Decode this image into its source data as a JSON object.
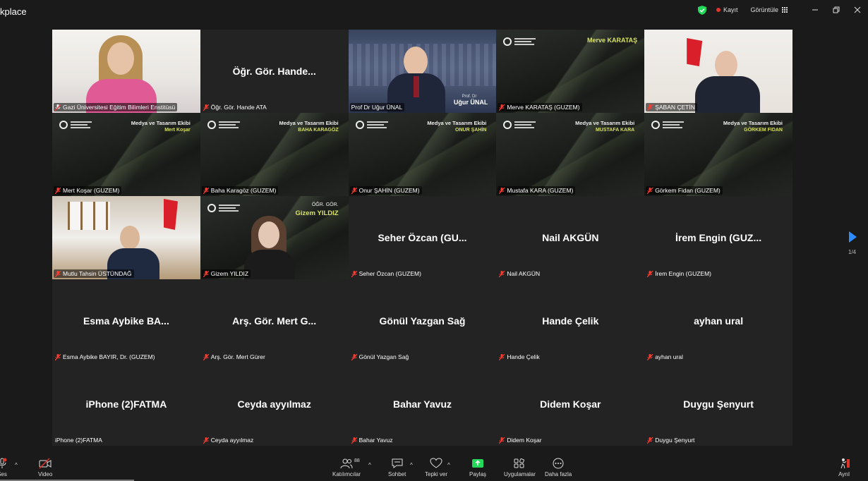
{
  "window": {
    "title": "kplace",
    "recording_label": "Kayıt",
    "view_label": "Görüntüle",
    "colors": {
      "accent": "#2d8cff",
      "active_speaker": "#23d959",
      "recording": "#e0332a",
      "share": "#23d959"
    }
  },
  "tiles": [
    {
      "label": "Gazi Üniversitesi Eğitim Bilimleri Enstitüsü",
      "center": "",
      "type": "photo-woman",
      "active": true
    },
    {
      "label": "Öğr. Gör. Hande ATA",
      "center": "Öğr. Gör. Hande...",
      "type": "plain"
    },
    {
      "label": "Prof Dr Uğur ÜNAL",
      "center": "",
      "type": "photo-prof",
      "caption1": "Prof. Dr",
      "caption2": "Uğur ÜNAL"
    },
    {
      "label": "Merve KARATAŞ (GUZEM)",
      "center": "",
      "type": "guzem-merve",
      "name": "Merve KARATAŞ"
    },
    {
      "label": "ŞABAN ÇETİN",
      "center": "",
      "type": "photo-office"
    },
    {
      "label": "Mert Koşar (GUZEM)",
      "center": "",
      "type": "guzem",
      "title": "Medya ve Tasarım Ekibi",
      "name": "Mert Koşar"
    },
    {
      "label": "Baha Karagöz (GUZEM)",
      "center": "",
      "type": "guzem",
      "title": "Medya ve Tasarım Ekibi",
      "name": "BAHA KARAGÖZ"
    },
    {
      "label": "Onur ŞAHİN (GUZEM)",
      "center": "",
      "type": "guzem",
      "title": "Medya ve Tasarım Ekibi",
      "name": "ONUR ŞAHİN"
    },
    {
      "label": "Mustafa KARA (GUZEM)",
      "center": "",
      "type": "guzem",
      "title": "Medya ve Tasarım Ekibi",
      "name": "MUSTAFA KARA"
    },
    {
      "label": "Görkem Fidan (GUZEM)",
      "center": "",
      "type": "guzem",
      "title": "Medya ve Tasarım Ekibi",
      "name": "GÖRKEM FIDAN"
    },
    {
      "label": "Mutlu Tahsin ÜSTÜNDAĞ",
      "center": "",
      "type": "photo-mutlu"
    },
    {
      "label": "Gizem YILDIZ",
      "center": "",
      "type": "guzem-gizem",
      "role": "ÖĞR. GÖR.",
      "name": "Gizem YILDIZ"
    },
    {
      "label": "Seher Özcan (GUZEM)",
      "center": "Seher Özcan (GU...",
      "type": "plain"
    },
    {
      "label": "Nail AKGÜN",
      "center": "Nail AKGÜN",
      "type": "plain"
    },
    {
      "label": "İrem Engin (GUZEM)",
      "center": "İrem Engin (GUZ...",
      "type": "plain"
    },
    {
      "label": "Esma Aybike BAYIR, Dr. (GUZEM)",
      "center": "Esma Aybike BA...",
      "type": "plain"
    },
    {
      "label": "Arş. Gör. Mert Gürer",
      "center": "Arş. Gör. Mert G...",
      "type": "plain"
    },
    {
      "label": "Gönül Yazgan Sağ",
      "center": "Gönül Yazgan Sağ",
      "type": "plain"
    },
    {
      "label": "Hande Çelik",
      "center": "Hande Çelik",
      "type": "plain"
    },
    {
      "label": "ayhan ural",
      "center": "ayhan ural",
      "type": "plain"
    },
    {
      "label": "iPhone (2)FATMA",
      "center": "iPhone (2)FATMA",
      "type": "plain",
      "no_mic_icon": true
    },
    {
      "label": "Ceyda ayyılmaz",
      "center": "Ceyda ayyılmaz",
      "type": "plain"
    },
    {
      "label": "Bahar Yavuz",
      "center": "Bahar Yavuz",
      "type": "plain"
    },
    {
      "label": "Didem Koşar",
      "center": "Didem Koşar",
      "type": "plain"
    },
    {
      "label": "Duygu Şenyurt",
      "center": "Duygu Şenyurt",
      "type": "plain"
    }
  ],
  "pagination": {
    "indicator": "1/4"
  },
  "toolbar": {
    "audio_label": "Ses",
    "video_label": "Video",
    "participants_label": "Katılımcılar",
    "participants_count": "88",
    "chat_label": "Sohbet",
    "reactions_label": "Tepki ver",
    "share_label": "Paylaş",
    "apps_label": "Uygulamalar",
    "more_label": "Daha fazla",
    "leave_label": "Ayrıl"
  }
}
